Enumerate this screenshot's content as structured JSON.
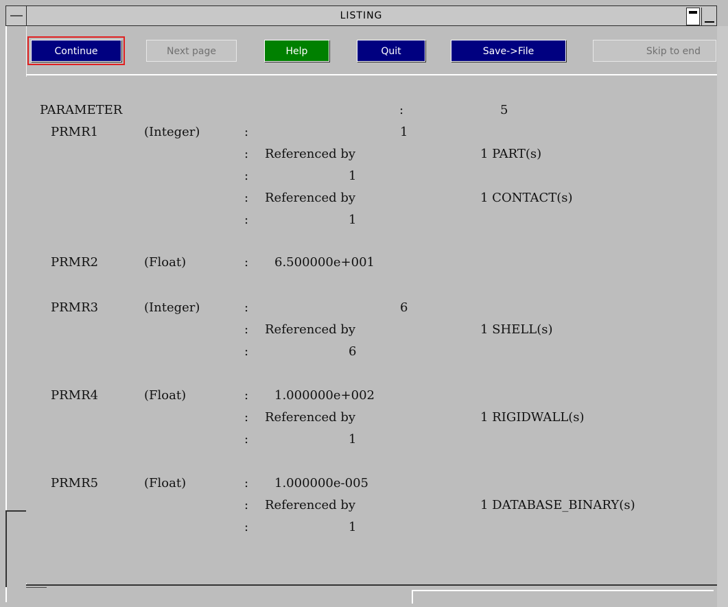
{
  "window": {
    "title": "LISTING"
  },
  "toolbar": {
    "continue_label": "Continue",
    "next_page_label": "Next page",
    "help_label": "Help",
    "quit_label": "Quit",
    "save_label": "Save->File",
    "skip_label": "Skip to end"
  },
  "colors": {
    "button_dark": "#000080",
    "button_help": "#008000",
    "focus_outline": "#e02020",
    "background": "#bdbdbd"
  },
  "listing": {
    "header": {
      "label": "PARAMETER",
      "colon": ":",
      "count": "5"
    },
    "params": [
      {
        "name": "PRMR1",
        "type": "(Integer)",
        "colon": ":",
        "value": "1",
        "refs": [
          {
            "colon": ":",
            "text": "Referenced by",
            "target": "1 PART(s)",
            "value_colon": ":",
            "value": "1"
          },
          {
            "colon": ":",
            "text": "Referenced by",
            "target": "1 CONTACT(s)",
            "value_colon": ":",
            "value": "1"
          }
        ]
      },
      {
        "name": "PRMR2",
        "type": "(Float)",
        "colon": ":",
        "value": "6.500000e+001",
        "refs": []
      },
      {
        "name": "PRMR3",
        "type": "(Integer)",
        "colon": ":",
        "value": "6",
        "refs": [
          {
            "colon": ":",
            "text": "Referenced by",
            "target": "1 SHELL(s)",
            "value_colon": ":",
            "value": "6"
          }
        ]
      },
      {
        "name": "PRMR4",
        "type": "(Float)",
        "colon": ":",
        "value": "1.000000e+002",
        "refs": [
          {
            "colon": ":",
            "text": "Referenced by",
            "target": "1 RIGIDWALL(s)",
            "value_colon": ":",
            "value": "1"
          }
        ]
      },
      {
        "name": "PRMR5",
        "type": "(Float)",
        "colon": ":",
        "value": "1.000000e-005",
        "refs": [
          {
            "colon": ":",
            "text": "Referenced by",
            "target": "1 DATABASE_BINARY(s)",
            "value_colon": ":",
            "value": "1"
          }
        ]
      }
    ]
  }
}
